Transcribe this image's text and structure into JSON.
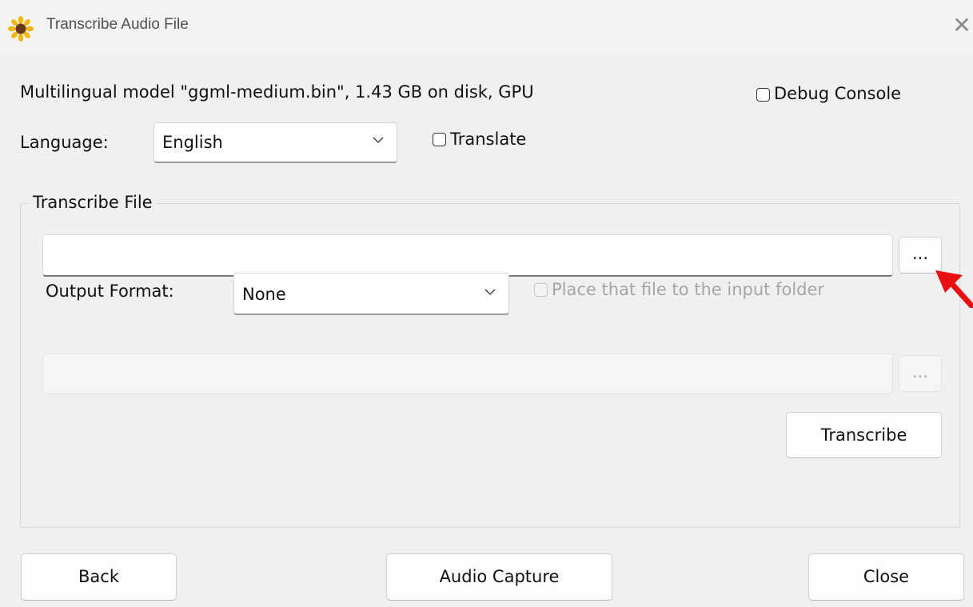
{
  "window": {
    "title": "Transcribe Audio File",
    "close_glyph": "✕"
  },
  "model_info": "Multilingual model \"ggml-medium.bin\", 1.43 GB on disk, GPU",
  "debug_console": {
    "label": "Debug Console",
    "checked": false
  },
  "language": {
    "label": "Language:",
    "value": "English"
  },
  "translate": {
    "label": "Translate",
    "checked": false
  },
  "transcribe_group": {
    "title": "Transcribe File",
    "input_file_value": "",
    "browse_label": "...",
    "output_format_label": "Output Format:",
    "output_format_value": "None",
    "place_in_input_folder": {
      "label": "Place that file to the input folder",
      "checked": false,
      "enabled": false
    },
    "output_file_value": "",
    "output_browse_label": "...",
    "transcribe_button": "Transcribe"
  },
  "footer": {
    "back": "Back",
    "audio_capture": "Audio Capture",
    "close": "Close"
  },
  "icons": {
    "app": "sunflower-icon",
    "chevron": "chevron-down-icon",
    "annotation": "red-arrow-icon"
  },
  "colors": {
    "annotation_arrow": "#e81010",
    "app_icon_petals": "#f2b705",
    "app_icon_center": "#6b3a12"
  }
}
